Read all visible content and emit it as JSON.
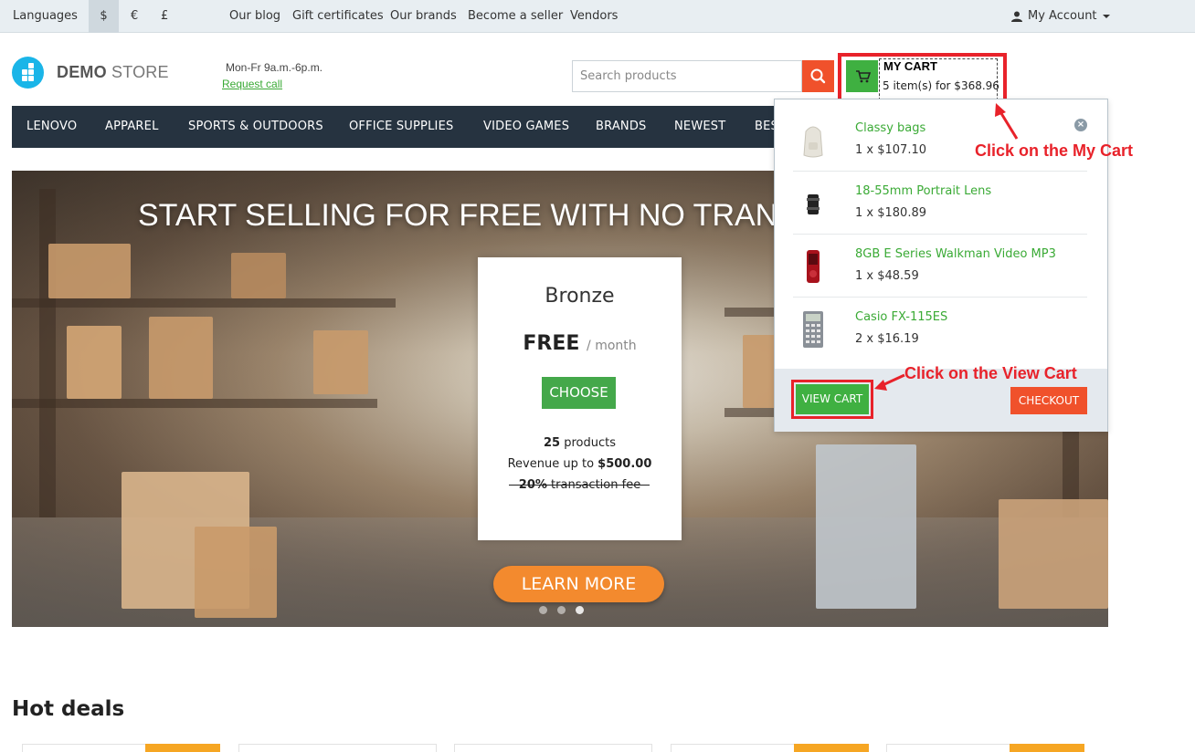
{
  "topbar": {
    "languages": "Languages",
    "currencies": [
      "$",
      "€",
      "£"
    ],
    "links": [
      "Our blog",
      "Gift certificates",
      "Our brands",
      "Become a seller",
      "Vendors"
    ],
    "account": "My Account"
  },
  "header": {
    "logo_bold": "DEMO",
    "logo_light": "STORE",
    "hours": "Mon-Fr 9a.m.-6p.m.",
    "request_call": "Request call",
    "search_placeholder": "Search products"
  },
  "cart": {
    "title": "MY CART",
    "summary": "5 item(s) for $368.96",
    "items": [
      {
        "name": "Classy bags",
        "qty": "1 x $107.10"
      },
      {
        "name": "18-55mm Portrait Lens",
        "qty": "1 x $180.89"
      },
      {
        "name": "8GB E Series Walkman Video MP3",
        "qty": "1 x $48.59"
      },
      {
        "name": "Casio FX-115ES",
        "qty": "2 x $16.19"
      }
    ],
    "remove": "×",
    "view_cart": "VIEW CART",
    "checkout": "CHECKOUT"
  },
  "nav": [
    "LENOVO",
    "APPAREL",
    "SPORTS & OUTDOORS",
    "OFFICE SUPPLIES",
    "VIDEO GAMES",
    "BRANDS",
    "NEWEST",
    "BES"
  ],
  "hero": {
    "title": "START SELLING FOR FREE WITH NO TRANS",
    "plan": {
      "name": "Bronze",
      "price": "FREE",
      "period": "/ month",
      "choose": "CHOOSE",
      "products_count": "25",
      "products_label": "products",
      "revenue_label": "Revenue up to",
      "revenue_value": "$500.00",
      "fee_value": "20%",
      "fee_label": "transaction fee"
    },
    "learn_more": "LEARN MORE"
  },
  "hot_deals": "Hot deals",
  "annotations": {
    "my_cart": "Click on the My Cart",
    "view_cart": "Click on the View Cart"
  },
  "colors": {
    "accent_green": "#3fb041",
    "accent_orange": "#f0512b",
    "annotation_red": "#e8222a",
    "nav_bg": "#263340"
  }
}
